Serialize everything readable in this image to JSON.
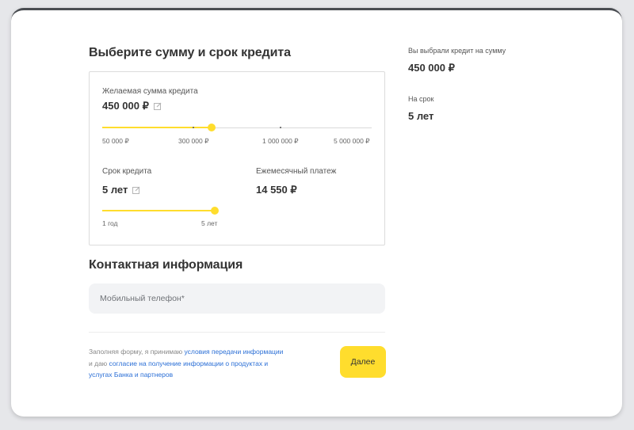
{
  "form": {
    "title": "Выберите сумму и срок кредита",
    "amount": {
      "label": "Желаемая сумма кредита",
      "value": "450 000 ₽",
      "ticks": [
        "50 000 ₽",
        "300 000 ₽",
        "1 000 000 ₽",
        "5 000 000 ₽"
      ]
    },
    "term": {
      "label": "Срок кредита",
      "value": "5 лет",
      "min_label": "1 год",
      "max_label": "5 лет"
    },
    "payment": {
      "label": "Ежемесячный платеж",
      "value": "14 550 ₽"
    }
  },
  "contact": {
    "title": "Контактная информация",
    "phone_placeholder": "Мобильный телефон*"
  },
  "consent": {
    "text1": "Заполняя форму, я принимаю ",
    "link1": "условия передачи информации",
    "text2": " и даю ",
    "link2": "согласие на получение информации о продуктах и услугах Банка и партнеров"
  },
  "submit_label": "Далее",
  "summary": {
    "amount_label": "Вы выбрали кредит на сумму",
    "amount_value": "450 000 ₽",
    "term_label": "На срок",
    "term_value": "5 лет"
  },
  "colors": {
    "accent": "#ffdd2d",
    "link": "#2b6fd6"
  },
  "icons": {
    "edit": "edit-icon"
  }
}
